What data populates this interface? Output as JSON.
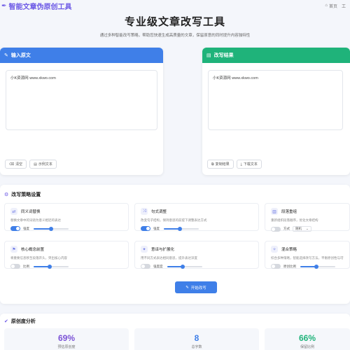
{
  "nav": {
    "brand": "智能文章伪原创工具",
    "links": [
      {
        "label": "首页",
        "icon": "home-icon"
      },
      {
        "label": "工"
      }
    ]
  },
  "hero": {
    "title": "专业级文章改写工具",
    "subtitle": "通过多种智能改写策略，帮助您快速生成高质量的文章，保留原意的同时提升内容独特性"
  },
  "input_panel": {
    "title": "输入原文",
    "content": "小K资源网 www.xkwo.com",
    "buttons": [
      "清空",
      "示例文本"
    ]
  },
  "output_panel": {
    "title": "改写结果",
    "content": "小K资源网 www.xkwo.com",
    "buttons": [
      "复制结果",
      "下载文本"
    ]
  },
  "settings": {
    "title": "改写策略设置",
    "cards": [
      {
        "title": "同义词替换",
        "desc": "替换文章中的词语为意义相近的表达",
        "enabled": true,
        "control_label": "强度",
        "slider": 0.5
      },
      {
        "title": "句式调整",
        "desc": "改变句子结构，保持意思的前提下调整表达方式",
        "enabled": true,
        "control_label": "强度",
        "slider": 0.45
      },
      {
        "title": "段落重组",
        "desc": "重新组织段落顺序，优化文章结构",
        "enabled": false,
        "control_label": "方式",
        "select": "随机"
      },
      {
        "title": "核心概念前置",
        "desc": "将重要信息移至段落开头，突出核心内容",
        "enabled": false,
        "control_label": "比例",
        "slider": 0.45
      },
      {
        "title": "意译与扩展化",
        "desc": "用不同方式表达相同意思，提升表达深度",
        "enabled": false,
        "control_label": "强度度",
        "slider": 0.45
      },
      {
        "title": "混合策略",
        "desc": "综合多种策略，智能选择改写方法，平衡原创性与可读性",
        "enabled": false,
        "control_label": "原创比例",
        "slider": 0.45
      }
    ],
    "start_button": "开始改写"
  },
  "analysis": {
    "title": "原创度分析",
    "stats": [
      {
        "value": "69%",
        "label": "预估原创度",
        "color": "#7b52d6"
      },
      {
        "value": "8",
        "label": "总字数",
        "color": "#3f7fe8"
      },
      {
        "value": "66%",
        "label": "保留比例",
        "color": "#1fb37a"
      }
    ]
  }
}
